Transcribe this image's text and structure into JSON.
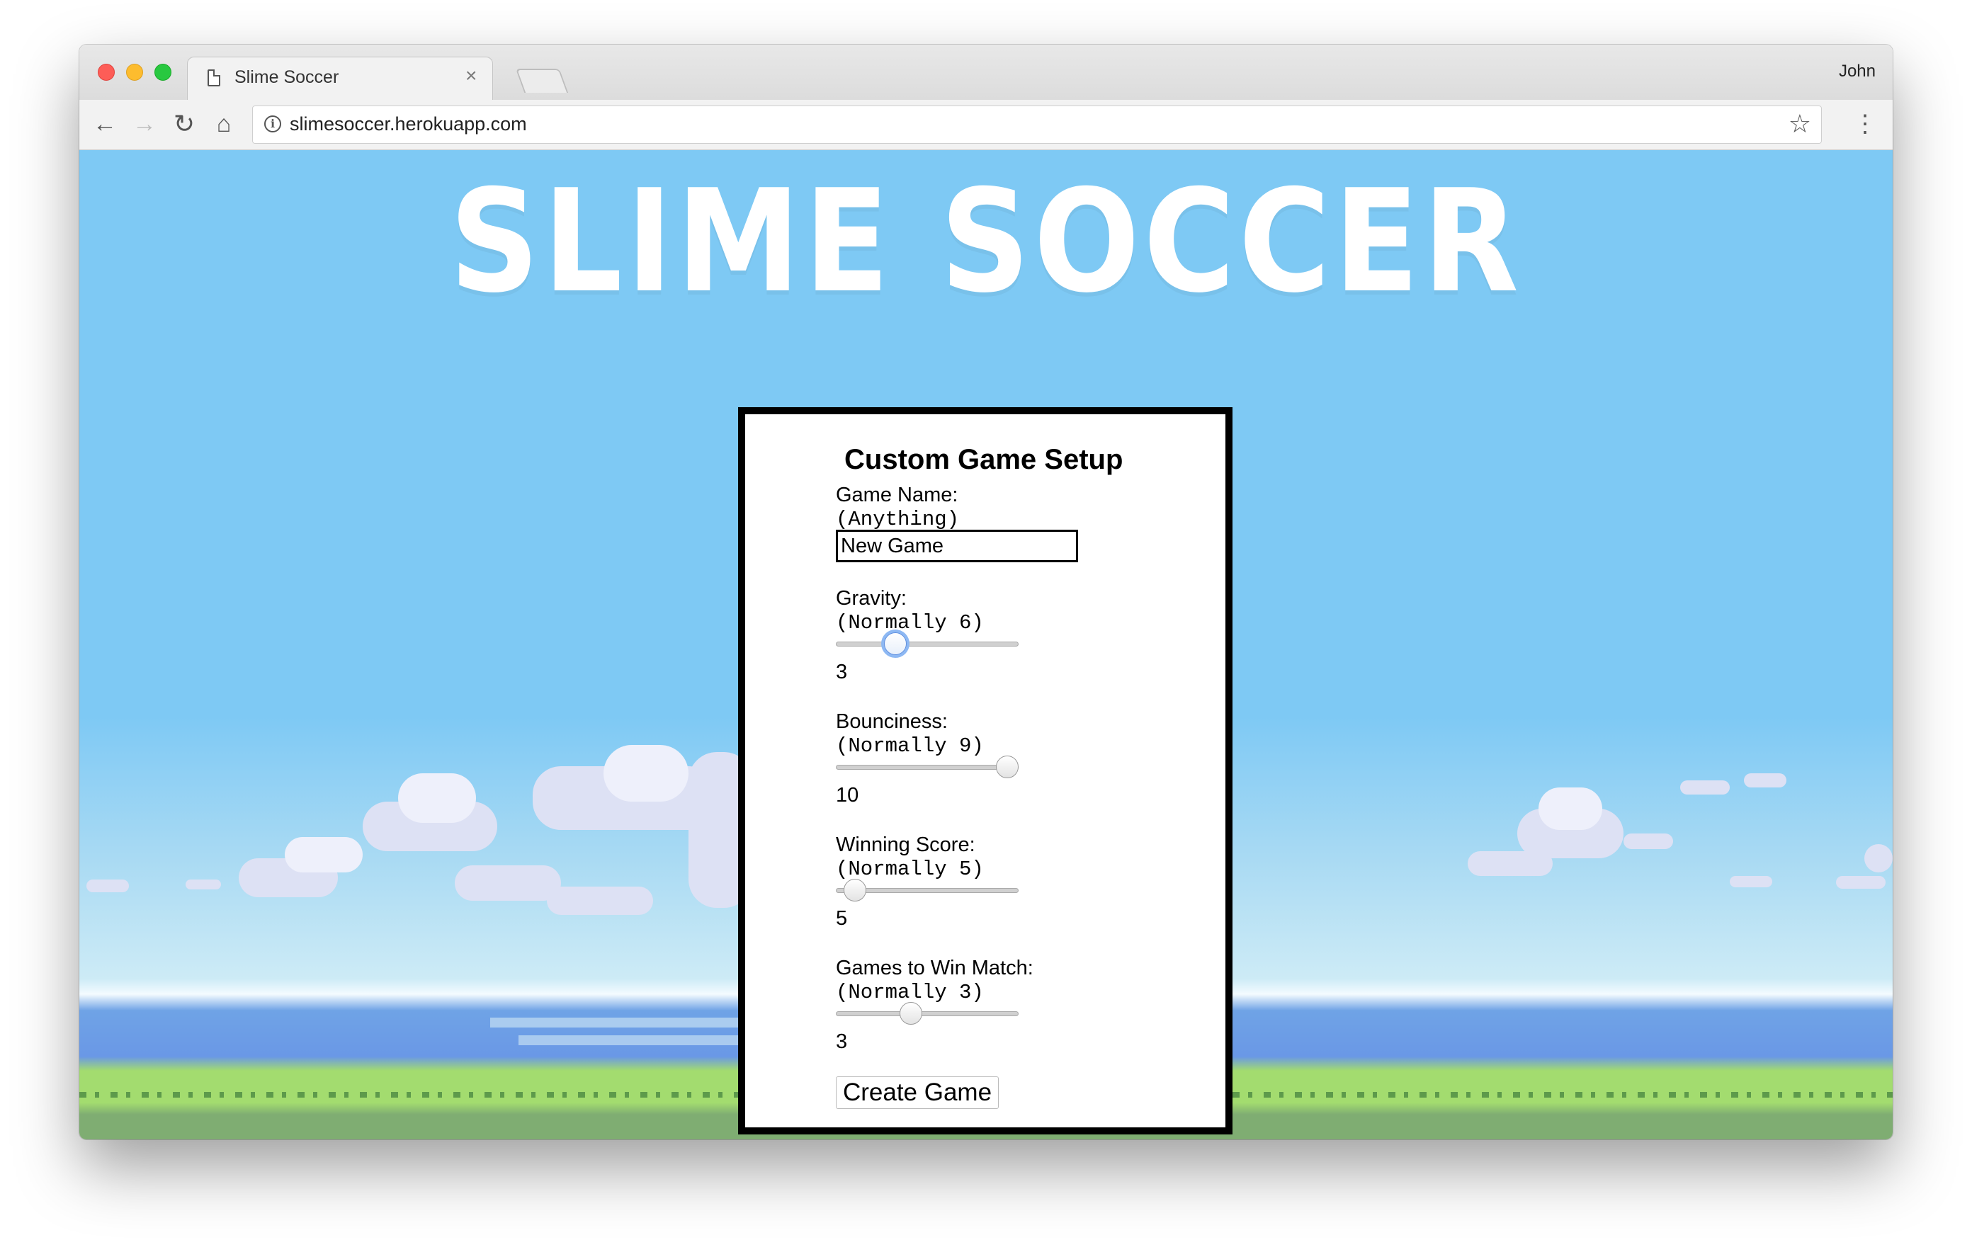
{
  "browser": {
    "tab_title": "Slime Soccer",
    "tab_close": "×",
    "profile_name": "John",
    "url": "slimesoccer.herokuapp.com",
    "icons": [
      "back-arrow-icon",
      "forward-arrow-icon",
      "reload-icon",
      "home-icon",
      "info-icon",
      "star-icon",
      "menu-icon",
      "page-icon",
      "close-icon"
    ]
  },
  "page": {
    "logo_text": "SLIME SOCCER"
  },
  "form": {
    "heading": "Custom Game Setup",
    "game_name": {
      "label": "Game Name:",
      "hint": "(Anything)",
      "value": "New Game"
    },
    "gravity": {
      "label": "Gravity:",
      "hint": "(Normally 6)",
      "value": "3",
      "slider_fraction": 0.3
    },
    "bounciness": {
      "label": "Bounciness:",
      "hint": "(Normally 9)",
      "value": "10",
      "slider_fraction": 1.0
    },
    "winning_score": {
      "label": "Winning Score:",
      "hint": "(Normally 5)",
      "value": "5",
      "slider_fraction": 0.05
    },
    "games_to_win": {
      "label": "Games to Win Match:",
      "hint": "(Normally 3)",
      "value": "3",
      "slider_fraction": 0.4
    },
    "submit_label": "Create Game"
  },
  "colors": {
    "sky": "#7ec9f4",
    "sea": "#6a98e6",
    "grass": "#a3dc6f",
    "ground": "#7fad72",
    "slider_focus": "#8db8f3"
  }
}
